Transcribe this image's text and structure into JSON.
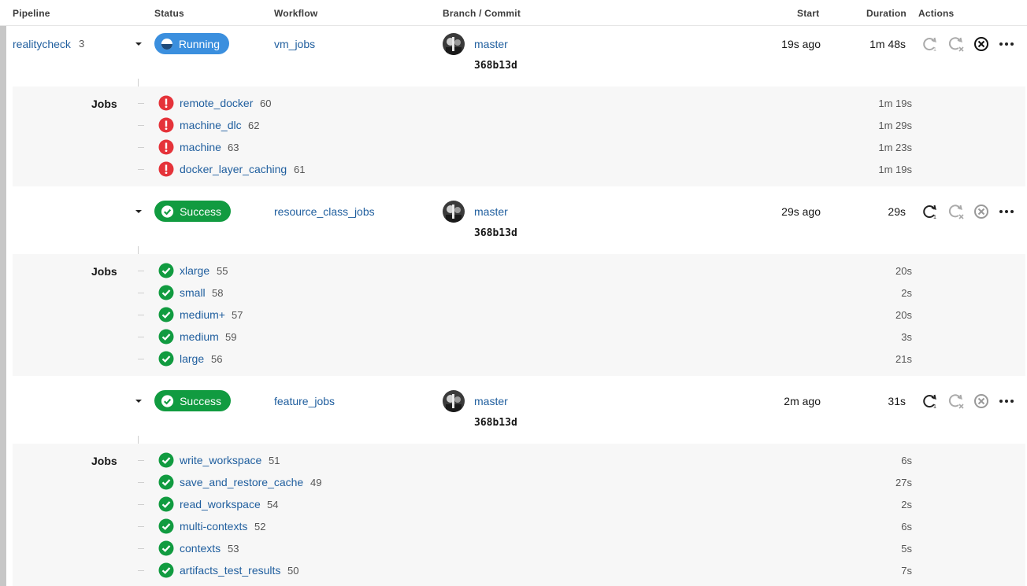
{
  "columns": {
    "pipeline": "Pipeline",
    "status": "Status",
    "workflow": "Workflow",
    "branch_commit": "Branch / Commit",
    "start": "Start",
    "duration": "Duration",
    "actions": "Actions"
  },
  "pipeline": {
    "name": "realitycheck",
    "number": "3"
  },
  "jobs_label": "Jobs",
  "colors": {
    "link": "#1f5e9e",
    "running": "#3b8fde",
    "success": "#119b40",
    "failed": "#e5333a"
  },
  "workflows": [
    {
      "status": "Running",
      "name": "vm_jobs",
      "branch": "master",
      "commit": "368b13d",
      "start": "19s ago",
      "duration": "1m 48s",
      "jobs": [
        {
          "name": "remote_docker",
          "number": "60",
          "duration": "1m 19s",
          "icon": "failed-icon"
        },
        {
          "name": "machine_dlc",
          "number": "62",
          "duration": "1m 29s",
          "icon": "failed-icon"
        },
        {
          "name": "machine",
          "number": "63",
          "duration": "1m 23s",
          "icon": "failed-icon"
        },
        {
          "name": "docker_layer_caching",
          "number": "61",
          "duration": "1m 19s",
          "icon": "failed-icon"
        }
      ]
    },
    {
      "status": "Success",
      "name": "resource_class_jobs",
      "branch": "master",
      "commit": "368b13d",
      "start": "29s ago",
      "duration": "29s",
      "jobs": [
        {
          "name": "xlarge",
          "number": "55",
          "duration": "20s",
          "icon": "success-icon"
        },
        {
          "name": "small",
          "number": "58",
          "duration": "2s",
          "icon": "success-icon"
        },
        {
          "name": "medium+",
          "number": "57",
          "duration": "20s",
          "icon": "success-icon"
        },
        {
          "name": "medium",
          "number": "59",
          "duration": "3s",
          "icon": "success-icon"
        },
        {
          "name": "large",
          "number": "56",
          "duration": "21s",
          "icon": "success-icon"
        }
      ]
    },
    {
      "status": "Success",
      "name": "feature_jobs",
      "branch": "master",
      "commit": "368b13d",
      "start": "2m ago",
      "duration": "31s",
      "jobs": [
        {
          "name": "write_workspace",
          "number": "51",
          "duration": "6s",
          "icon": "success-icon"
        },
        {
          "name": "save_and_restore_cache",
          "number": "49",
          "duration": "27s",
          "icon": "success-icon"
        },
        {
          "name": "read_workspace",
          "number": "54",
          "duration": "2s",
          "icon": "success-icon"
        },
        {
          "name": "multi-contexts",
          "number": "52",
          "duration": "6s",
          "icon": "success-icon"
        },
        {
          "name": "contexts",
          "number": "53",
          "duration": "5s",
          "icon": "success-icon"
        },
        {
          "name": "artifacts_test_results",
          "number": "50",
          "duration": "7s",
          "icon": "success-icon"
        }
      ]
    }
  ]
}
